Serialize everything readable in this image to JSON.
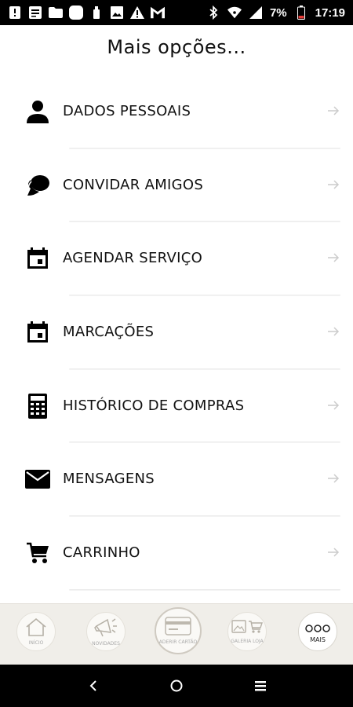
{
  "status_bar": {
    "battery_percent": "7%",
    "time": "17:19",
    "icons": [
      "alert-icon",
      "message-icon",
      "folder-icon",
      "app-icon",
      "bottle-icon",
      "image-icon",
      "warning-icon",
      "gmail-icon",
      "bluetooth-icon",
      "wifi-icon",
      "signal-icon",
      "battery-icon"
    ]
  },
  "header": {
    "title": "Mais opções..."
  },
  "menu": {
    "items": [
      {
        "label": "DADOS PESSOAIS",
        "icon": "person-icon"
      },
      {
        "label": "CONVIDAR AMIGOS",
        "icon": "chat-bubbles-icon"
      },
      {
        "label": "AGENDAR SERVIÇO",
        "icon": "calendar-icon"
      },
      {
        "label": "MARCAÇÕES",
        "icon": "calendar-icon"
      },
      {
        "label": "HISTÓRICO DE COMPRAS",
        "icon": "calculator-icon"
      },
      {
        "label": "MENSAGENS",
        "icon": "envelope-icon"
      },
      {
        "label": "CARRINHO",
        "icon": "cart-icon"
      }
    ]
  },
  "bottom_nav": {
    "tabs": [
      {
        "label": "INÍCIO",
        "icon": "home-icon"
      },
      {
        "label": "NOVIDADES",
        "icon": "megaphone-icon"
      },
      {
        "label": "ADERIR CARTÃO",
        "icon": "card-icon"
      },
      {
        "label": "GALERIA LOJA",
        "icon": "gallery-cart-icon"
      },
      {
        "label": "MAIS",
        "icon": "three-dots-icon"
      }
    ]
  },
  "system_nav": {
    "buttons": [
      "back-icon",
      "home-circle-icon",
      "recents-icon"
    ]
  },
  "colors": {
    "text": "#111111",
    "bottom_bar_bg": "#f0eee9",
    "divider": "#ececec",
    "arrow": "#cccccc"
  }
}
